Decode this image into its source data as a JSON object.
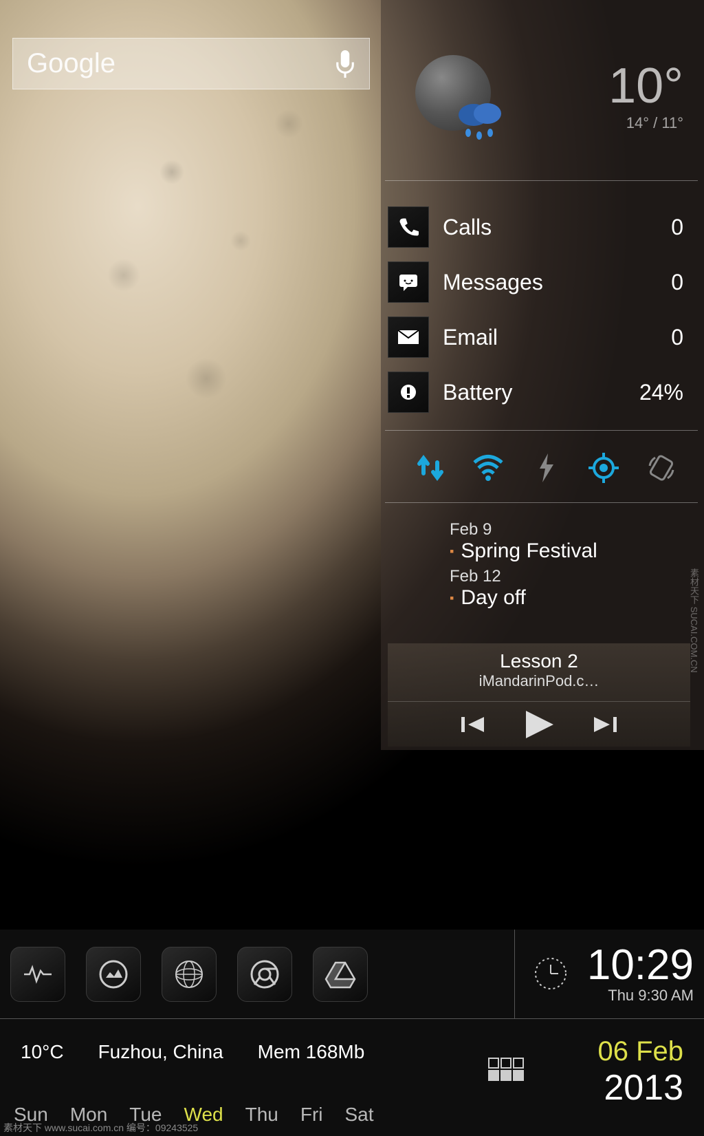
{
  "search": {
    "logo": "Google"
  },
  "weather": {
    "temp": "10°",
    "range": "14° / 11°",
    "condition": "night-rain"
  },
  "status": [
    {
      "icon": "phone",
      "label": "Calls",
      "value": "0"
    },
    {
      "icon": "message",
      "label": "Messages",
      "value": "0"
    },
    {
      "icon": "email",
      "label": "Email",
      "value": "0"
    },
    {
      "icon": "battery",
      "label": "Battery",
      "value": "24%"
    }
  ],
  "toggles": {
    "data": true,
    "wifi": true,
    "flash": false,
    "gps": true,
    "rotate": false
  },
  "events": [
    {
      "date": "Feb 9",
      "title": "Spring Festival"
    },
    {
      "date": "Feb 12",
      "title": "Day off"
    }
  ],
  "media": {
    "title": "Lesson 2",
    "subtitle": "iMandarinPod.c…"
  },
  "clock": {
    "time": "10:29",
    "alarm": "Thu 9:30 AM"
  },
  "info": {
    "temp": "10°C",
    "location": "Fuzhou, China",
    "mem": "Mem 168Mb"
  },
  "date": {
    "day_month": "06 Feb",
    "year": "2013"
  },
  "week": [
    "Sun",
    "Mon",
    "Tue",
    "Wed",
    "Thu",
    "Fri",
    "Sat"
  ],
  "week_active": "Wed",
  "dock_icons": [
    "activity",
    "gallery",
    "globe",
    "chrome",
    "drive"
  ],
  "watermark": {
    "bottom": "素材天下 www.sucai.com.cn  编号：09243525",
    "right": "素材天下 SUCAI.COM.CN"
  }
}
